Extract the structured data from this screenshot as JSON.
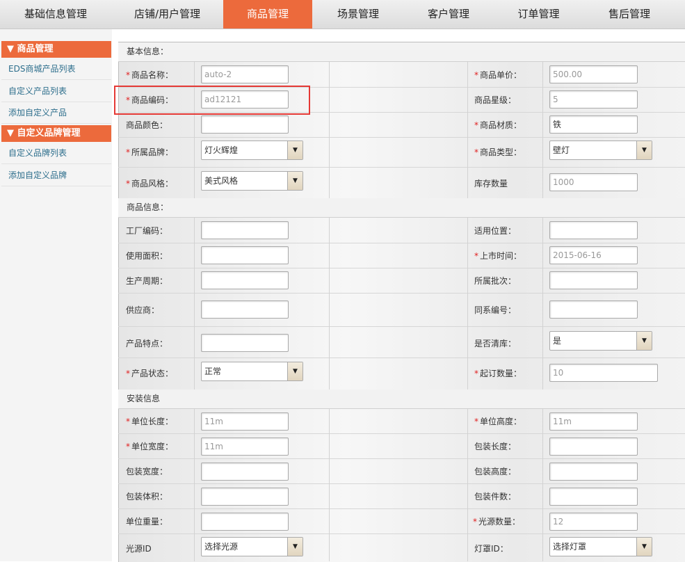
{
  "topnav": {
    "tabs": [
      "基础信息管理",
      "店铺/用户管理",
      "商品管理",
      "场景管理",
      "客户管理",
      "订单管理",
      "售后管理"
    ],
    "active_index": 2,
    "accent": "#ec6a3c"
  },
  "sidebar": {
    "section1": "▼ 商品管理",
    "items1": [
      "EDS商城产品列表",
      "自定义产品列表",
      "添加自定义产品"
    ],
    "section2": "▼ 自定义品牌管理",
    "items2": [
      "自定义品牌列表",
      "添加自定义品牌"
    ]
  },
  "sections": {
    "basic": "基本信息：",
    "product": "商品信息：",
    "install": "安装信息"
  },
  "fields": {
    "name": {
      "label": "商品名称：",
      "value": "auto-2",
      "required": true
    },
    "price": {
      "label": "商品单价：",
      "value": "500.00",
      "required": true
    },
    "code": {
      "label": "商品编码：",
      "value": "ad12121",
      "required": true
    },
    "stars": {
      "label": "商品星级：",
      "value": "5",
      "required": false
    },
    "color": {
      "label": "商品颜色：",
      "value": "",
      "required": false
    },
    "material": {
      "label": "商品材质：",
      "value": "铁",
      "required": true
    },
    "brand": {
      "label": "所属品牌：",
      "value": "灯火辉煌",
      "required": true
    },
    "type": {
      "label": "商品类型：",
      "value": "壁灯",
      "required": true
    },
    "style": {
      "label": "商品风格：",
      "value": "美式风格",
      "required": true
    },
    "stock": {
      "label": "库存数量",
      "value": "1000",
      "required": false
    },
    "factory": {
      "label": "工厂编码：",
      "value": "",
      "required": false
    },
    "position": {
      "label": "适用位置：",
      "value": "",
      "required": false
    },
    "area": {
      "label": "使用面积：",
      "value": "",
      "required": false
    },
    "launch": {
      "label": "上市时间：",
      "value": "2015-06-16",
      "required": true
    },
    "period": {
      "label": "生产周期：",
      "value": "",
      "required": false
    },
    "batch": {
      "label": "所属批次：",
      "value": "",
      "required": false
    },
    "supplier": {
      "label": "供应商：",
      "value": "",
      "required": false
    },
    "series": {
      "label": "同系编号：",
      "value": "",
      "required": false
    },
    "features": {
      "label": "产品特点：",
      "value": "",
      "required": false
    },
    "clearance": {
      "label": "是否清库：",
      "value": "是",
      "required": false
    },
    "status": {
      "label": "产品状态：",
      "value": "正常",
      "required": true
    },
    "moq": {
      "label": "起订数量：",
      "value": "10",
      "required": true
    },
    "ulen": {
      "label": "单位长度：",
      "value": "11m",
      "required": true
    },
    "uheight": {
      "label": "单位高度：",
      "value": "11m",
      "required": true
    },
    "uwidth": {
      "label": "单位宽度：",
      "value": "11m",
      "required": true
    },
    "plen": {
      "label": "包装长度：",
      "value": "",
      "required": false
    },
    "pwidth": {
      "label": "包装宽度：",
      "value": "",
      "required": false
    },
    "pheight": {
      "label": "包装高度：",
      "value": "",
      "required": false
    },
    "pvol": {
      "label": "包装体积：",
      "value": "",
      "required": false
    },
    "pcount": {
      "label": "包装件数：",
      "value": "",
      "required": false
    },
    "uweight": {
      "label": "单位重量：",
      "value": "",
      "required": false
    },
    "lightcount": {
      "label": "光源数量：",
      "value": "12",
      "required": true
    },
    "lightid": {
      "label": "光源ID",
      "value": "选择光源",
      "required": false
    },
    "shade": {
      "label": "灯罩ID：",
      "value": "选择灯罩",
      "required": false
    }
  }
}
